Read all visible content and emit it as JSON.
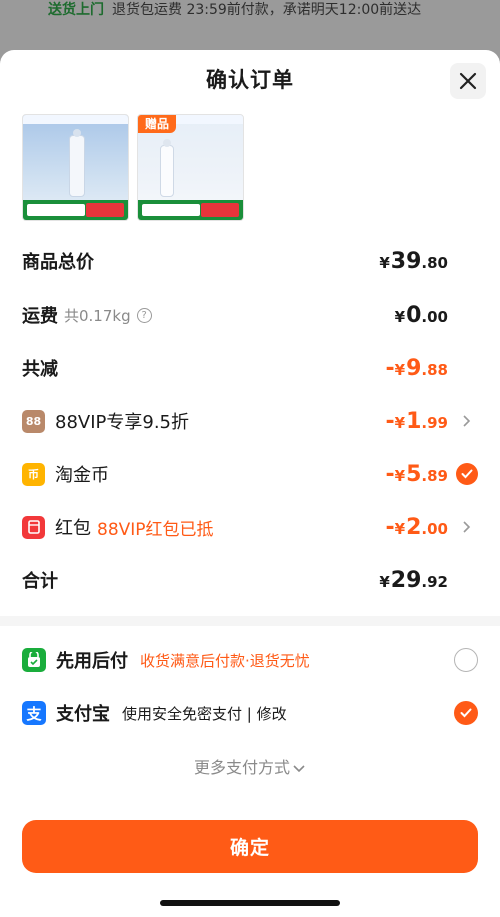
{
  "banner": {
    "highlight": "送货上门",
    "text": "退货包运费 23:59前付款，承诺明天12:00前送达"
  },
  "sheet": {
    "title": "确认订单"
  },
  "products": [
    {
      "name": "product-thumb-1",
      "has_gift": false
    },
    {
      "name": "product-thumb-2",
      "has_gift": true,
      "gift_label": "赠品"
    }
  ],
  "summary": {
    "subtotal": {
      "label": "商品总价",
      "yen": "¥",
      "int": "39",
      "dec": ".80"
    },
    "shipping": {
      "label": "运费",
      "weight": "共0.17kg",
      "help": "?",
      "yen": "¥",
      "int": "0",
      "dec": ".00"
    },
    "total_discount": {
      "label": "共减",
      "prefix": "-",
      "yen": "¥",
      "int": "9",
      "dec": ".88"
    },
    "vip": {
      "badge": "88",
      "label": "88VIP专享9.5折",
      "prefix": "-",
      "yen": "¥",
      "int": "1",
      "dec": ".99"
    },
    "coins": {
      "badge": "币",
      "label": "淘金币",
      "prefix": "-",
      "yen": "¥",
      "int": "5",
      "dec": ".89"
    },
    "redpacket": {
      "label": "红包",
      "note": "88VIP红包已抵",
      "prefix": "-",
      "yen": "¥",
      "int": "2",
      "dec": ".00"
    },
    "total": {
      "label": "合计",
      "yen": "¥",
      "int": "29",
      "dec": ".92"
    }
  },
  "payment": {
    "methods": [
      {
        "name": "先用后付",
        "desc": "收货满意后付款·退货无忧",
        "desc_color": "#ff5a16",
        "selected": false
      },
      {
        "name": "支付宝",
        "desc": "使用安全免密支付 | 修改",
        "desc_color": "#1a1a1a",
        "selected": true
      }
    ],
    "more": "更多支付方式"
  },
  "confirm_label": "确定",
  "colors": {
    "accent": "#ff5a16",
    "alipay": "#1677ff",
    "green": "#1aad3c"
  }
}
